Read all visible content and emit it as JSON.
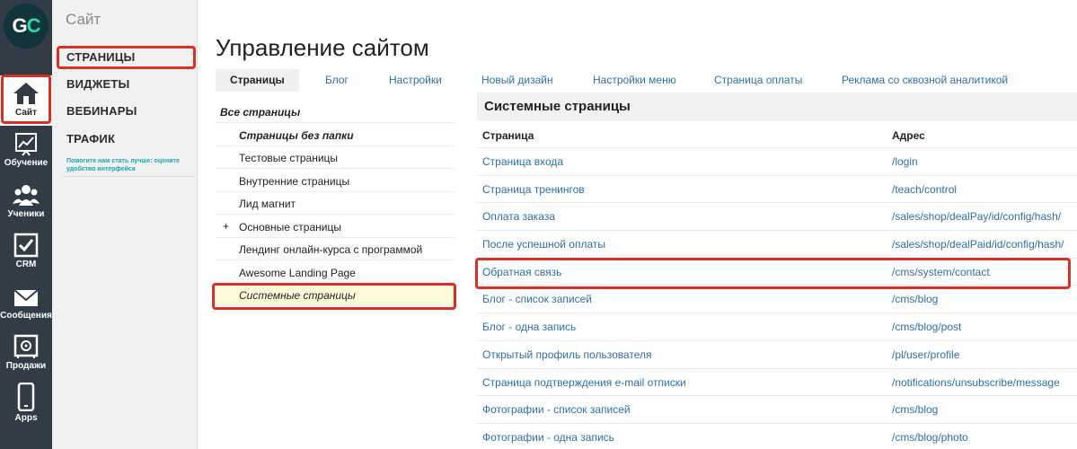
{
  "rail": {
    "logo_g": "G",
    "logo_c": "C",
    "items": [
      {
        "label": "Сайт",
        "icon": "home-icon"
      },
      {
        "label": "Обучение",
        "icon": "chart-board-icon"
      },
      {
        "label": "Ученики",
        "icon": "users-icon"
      },
      {
        "label": "CRM",
        "icon": "checkbox-icon"
      },
      {
        "label": "Сообщения",
        "icon": "envelope-icon"
      },
      {
        "label": "Продажи",
        "icon": "safe-icon"
      },
      {
        "label": "Apps",
        "icon": "phone-icon"
      }
    ]
  },
  "subnav": {
    "title": "Сайт",
    "items": [
      "СТРАНИЦЫ",
      "ВИДЖЕТЫ",
      "ВЕБИНАРЫ",
      "ТРАФИК"
    ],
    "help": "Помогите нам стать лучше: оцените удобство интерфейса"
  },
  "main": {
    "title": "Управление сайтом",
    "tabs": [
      "Страницы",
      "Блог",
      "Настройки",
      "Новый дизайн",
      "Настройки меню",
      "Страница оплаты",
      "Реклама со сквозной аналитикой"
    ]
  },
  "folders": {
    "all": "Все страницы",
    "items": [
      "Страницы без папки",
      "Тестовые страницы",
      "Внутренние страницы",
      "Лид магнит",
      "Основные страницы",
      "Лендинг онлайн-курса с программой",
      "Awesome Landing Page",
      "Системные страницы"
    ],
    "expand_symbol": "+"
  },
  "system": {
    "title": "Системные страницы",
    "headers": [
      "Страница",
      "Адрес"
    ],
    "rows": [
      [
        "Страница входа",
        "/login"
      ],
      [
        "Страница тренингов",
        "/teach/control"
      ],
      [
        "Оплата заказа",
        "/sales/shop/dealPay/id/config/hash/"
      ],
      [
        "После успешной оплаты",
        "/sales/shop/dealPaid/id/config/hash/"
      ],
      [
        "Обратная связь",
        "/cms/system/contact"
      ],
      [
        "Блог - список записей",
        "/cms/blog"
      ],
      [
        "Блог - одна запись",
        "/cms/blog/post"
      ],
      [
        "Открытый профиль пользователя",
        "/pl/user/profile"
      ],
      [
        "Страница подтверждения e-mail отписки",
        "/notifications/unsubscribe/message"
      ],
      [
        "Фотографии - список записей",
        "/cms/blog"
      ],
      [
        "Фотографии - одна запись",
        "/cms/blog/photo"
      ]
    ]
  },
  "colors": {
    "rail_bg": "#323c47",
    "link": "#2f6fa7",
    "highlight_border": "#d93025",
    "selected_bg": "#fffbd8",
    "help_text": "#14a9b3"
  }
}
